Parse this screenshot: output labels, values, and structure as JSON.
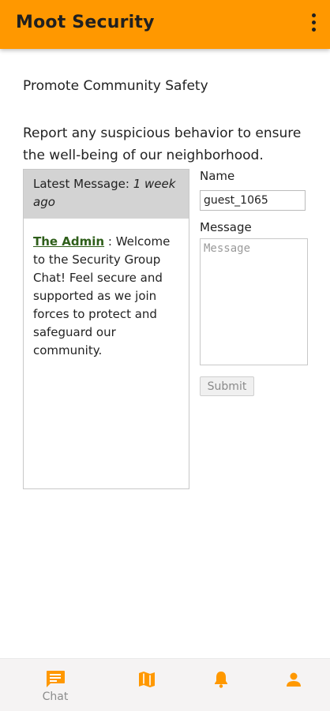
{
  "app": {
    "title": "Moot Security",
    "menu_icon": "more-vert-icon",
    "accent_color": "#FF9800"
  },
  "intro": {
    "title": "Promote Community Safety",
    "description": "Report any suspicious behavior to ensure the well-being of our neighborhood."
  },
  "chat": {
    "header_prefix": "Latest Message:",
    "header_time": "1 week ago",
    "messages": [
      {
        "author": "The Admin",
        "separator": " : ",
        "text": "Welcome to the Security Group Chat! Feel secure and supported as we join forces to protect and safeguard our community."
      }
    ]
  },
  "form": {
    "name_label": "Name",
    "name_value": "guest_1065",
    "message_label": "Message",
    "message_placeholder": "Message",
    "submit_label": "Submit"
  },
  "bottom_nav": {
    "items": [
      {
        "icon": "chat-icon",
        "label": "Chat",
        "active": true
      },
      {
        "icon": "map-icon",
        "label": ""
      },
      {
        "icon": "bell-icon",
        "label": ""
      },
      {
        "icon": "person-icon",
        "label": ""
      }
    ]
  }
}
